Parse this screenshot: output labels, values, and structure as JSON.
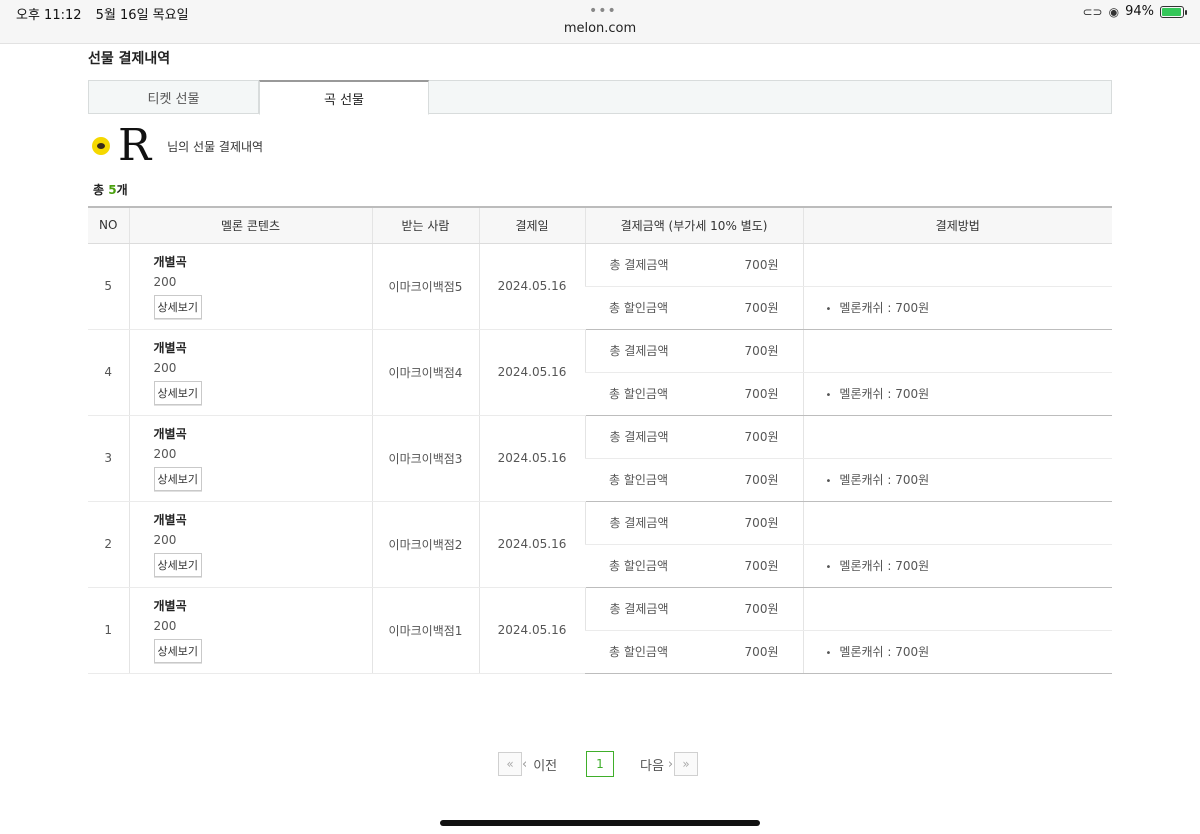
{
  "status": {
    "time": "오후 11:12",
    "date": "5월 16일 목요일",
    "url": "melon.com",
    "battery": "94%",
    "battery_level": 0.94
  },
  "page": {
    "title": "선물 결제내역"
  },
  "tabs": [
    {
      "label": "티켓 선물"
    },
    {
      "label": "곡 선물"
    }
  ],
  "user": {
    "initial": "R",
    "desc": "님의 선물 결제내역"
  },
  "summary": {
    "prefix": "총 ",
    "count": "5",
    "suffix": "개"
  },
  "table": {
    "headers": [
      "NO",
      "멜론 콘텐츠",
      "받는 사람",
      "결제일",
      "결제금액 (부가세 10% 별도)",
      "결제방법"
    ],
    "rows": [
      {
        "no": "5",
        "title": "개별곡",
        "sub": "200",
        "detail": "상세보기",
        "recipient": "이마크이백점5",
        "date": "2024.05.16",
        "total_label": "총 결제금액",
        "total_amount": "700원",
        "discount_label": "총 할인금액",
        "discount_amount": "700원",
        "method": "멜론캐쉬 : 700원"
      },
      {
        "no": "4",
        "title": "개별곡",
        "sub": "200",
        "detail": "상세보기",
        "recipient": "이마크이백점4",
        "date": "2024.05.16",
        "total_label": "총 결제금액",
        "total_amount": "700원",
        "discount_label": "총 할인금액",
        "discount_amount": "700원",
        "method": "멜론캐쉬 : 700원"
      },
      {
        "no": "3",
        "title": "개별곡",
        "sub": "200",
        "detail": "상세보기",
        "recipient": "이마크이백점3",
        "date": "2024.05.16",
        "total_label": "총 결제금액",
        "total_amount": "700원",
        "discount_label": "총 할인금액",
        "discount_amount": "700원",
        "method": "멜론캐쉬 : 700원"
      },
      {
        "no": "2",
        "title": "개별곡",
        "sub": "200",
        "detail": "상세보기",
        "recipient": "이마크이백점2",
        "date": "2024.05.16",
        "total_label": "총 결제금액",
        "total_amount": "700원",
        "discount_label": "총 할인금액",
        "discount_amount": "700원",
        "method": "멜론캐쉬 : 700원"
      },
      {
        "no": "1",
        "title": "개별곡",
        "sub": "200",
        "detail": "상세보기",
        "recipient": "이마크이백점1",
        "date": "2024.05.16",
        "total_label": "총 결제금액",
        "total_amount": "700원",
        "discount_label": "총 할인금액",
        "discount_amount": "700원",
        "method": "멜론캐쉬 : 700원"
      }
    ]
  },
  "pagination": {
    "first_icon": "double-left-icon",
    "prev": "이전",
    "current": "1",
    "next": "다음",
    "last_icon": "double-right-icon"
  },
  "colors": {
    "accent_green": "#3fae2a",
    "kakao_yellow": "#f5d800"
  }
}
